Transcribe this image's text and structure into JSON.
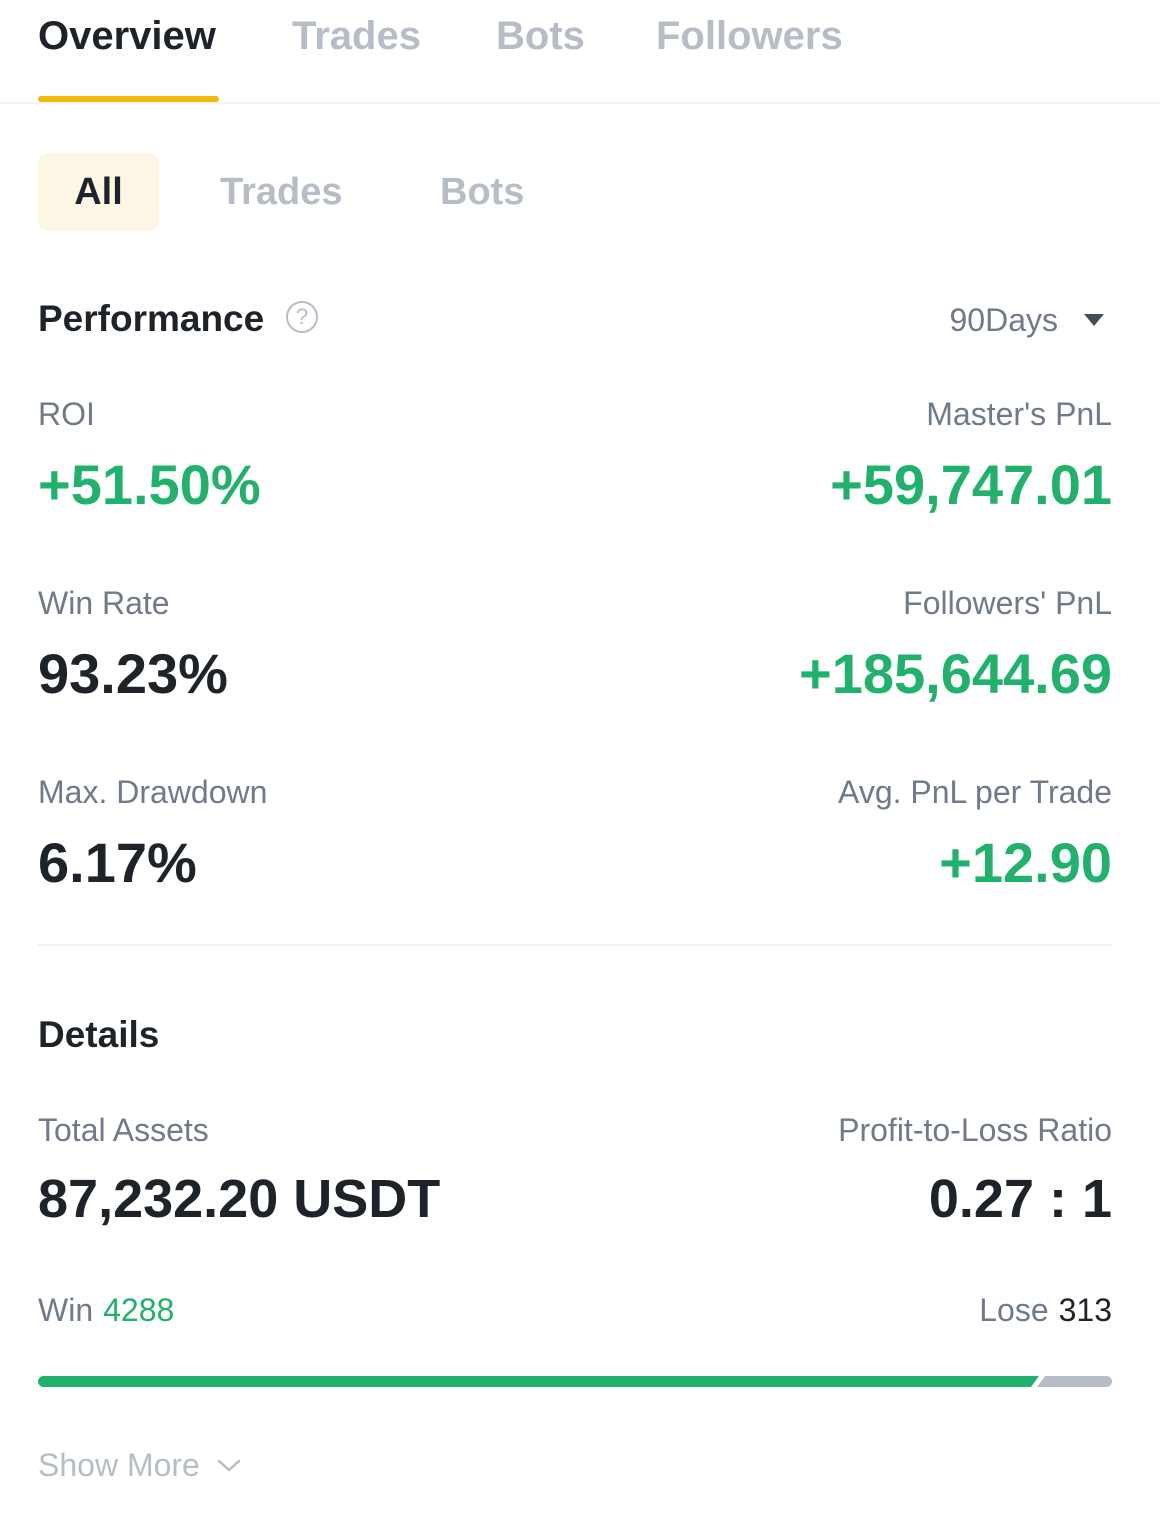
{
  "top_tabs": [
    "Overview",
    "Trades",
    "Bots",
    "Followers"
  ],
  "sub_tabs": [
    "All",
    "Trades",
    "Bots"
  ],
  "performance": {
    "title": "Performance",
    "period": "90Days",
    "roi_label": "ROI",
    "roi_value": "+51.50%",
    "master_pnl_label": "Master's PnL",
    "master_pnl_value": "+59,747.01",
    "win_rate_label": "Win Rate",
    "win_rate_value": "93.23%",
    "followers_pnl_label": "Followers' PnL",
    "followers_pnl_value": "+185,644.69",
    "max_drawdown_label": "Max. Drawdown",
    "max_drawdown_value": "6.17%",
    "avg_pnl_label": "Avg. PnL per Trade",
    "avg_pnl_value": "+12.90"
  },
  "details": {
    "title": "Details",
    "total_assets_label": "Total Assets",
    "total_assets_value": "87,232.20 USDT",
    "pl_ratio_label": "Profit-to-Loss Ratio",
    "pl_ratio_value": "0.27 : 1",
    "win_label": "Win",
    "win_count": "4288",
    "lose_label": "Lose",
    "lose_count": "313",
    "win_fraction": 0.932
  },
  "show_more": "Show More",
  "icons": {
    "help": "question-circle-icon",
    "caret": "caret-down-icon",
    "chevron": "chevron-down-icon"
  },
  "colors": {
    "accent": "#f0b90b",
    "positive": "#20b26c",
    "muted": "#b7bdc6"
  }
}
